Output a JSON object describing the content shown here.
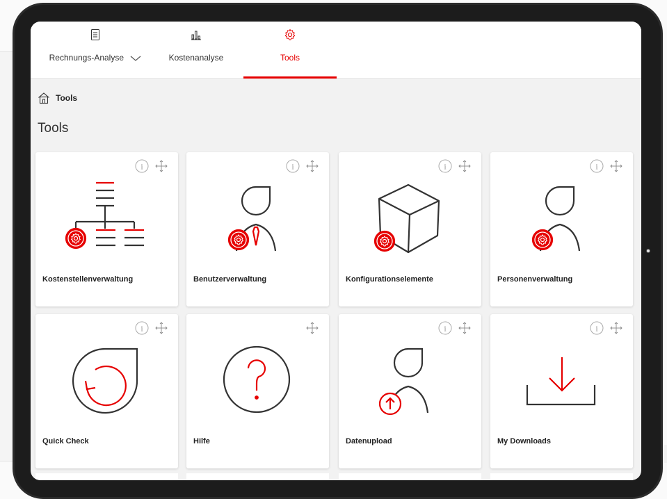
{
  "nav": {
    "tabs": [
      {
        "label": "Rechnungs-Analyse",
        "icon": "document-icon",
        "has_dropdown": true,
        "active": false
      },
      {
        "label": "Kostenanalyse",
        "icon": "bar-chart-icon",
        "has_dropdown": false,
        "active": false
      },
      {
        "label": "Tools",
        "icon": "gear-icon",
        "has_dropdown": false,
        "active": true
      }
    ]
  },
  "breadcrumb": {
    "label": "Tools",
    "icon": "home-icon"
  },
  "page": {
    "title": "Tools"
  },
  "tiles": [
    {
      "label": "Kostenstellenverwaltung",
      "icon": "org-chart-gear-icon",
      "has_info": true
    },
    {
      "label": "Benutzerverwaltung",
      "icon": "user-gear-icon",
      "has_info": true
    },
    {
      "label": "Konfigurationselemente",
      "icon": "box-gear-icon",
      "has_info": true
    },
    {
      "label": "Personenverwaltung",
      "icon": "person-gear-icon",
      "has_info": true
    },
    {
      "label": "Quick Check",
      "icon": "refresh-drop-icon",
      "has_info": true
    },
    {
      "label": "Hilfe",
      "icon": "question-icon",
      "has_info": false
    },
    {
      "label": "Datenupload",
      "icon": "person-upload-icon",
      "has_info": true
    },
    {
      "label": "My Downloads",
      "icon": "download-icon",
      "has_info": true
    }
  ],
  "colors": {
    "accent": "#e60000",
    "line": "#333333",
    "background": "#f2f2f2",
    "card": "#ffffff"
  }
}
